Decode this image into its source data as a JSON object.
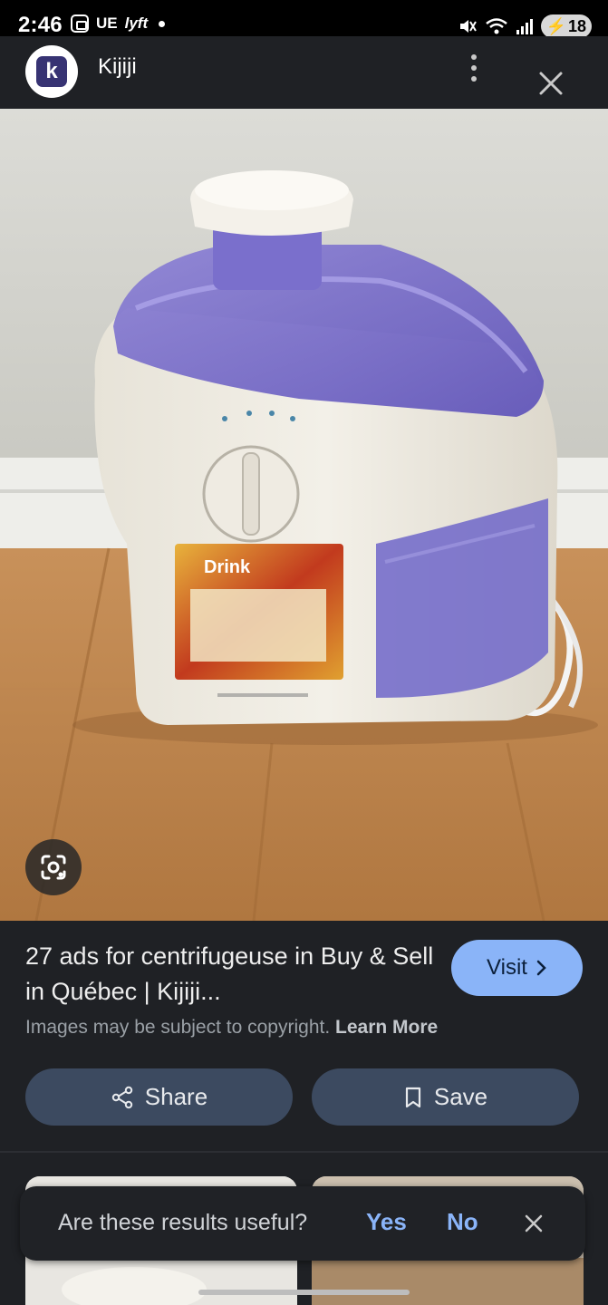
{
  "status_bar": {
    "time": "2:46",
    "left_text": "UE",
    "battery": "18"
  },
  "header": {
    "avatar_letter": "k",
    "site_name": "Kijiji"
  },
  "image": {
    "label_text": "Drink"
  },
  "result": {
    "title": "27 ads for centrifugeuse in Buy & Sell in Québec | Kijiji...",
    "visit_label": "Visit",
    "copyright_text": "Images may be subject to copyright.",
    "learn_more": "Learn More"
  },
  "actions": {
    "share_label": "Share",
    "save_label": "Save"
  },
  "feedback": {
    "question": "Are these results useful?",
    "yes": "Yes",
    "no": "No"
  },
  "colors": {
    "background": "#1f2125",
    "accent": "#8ab4f8",
    "button_bg": "#3c4a60"
  }
}
